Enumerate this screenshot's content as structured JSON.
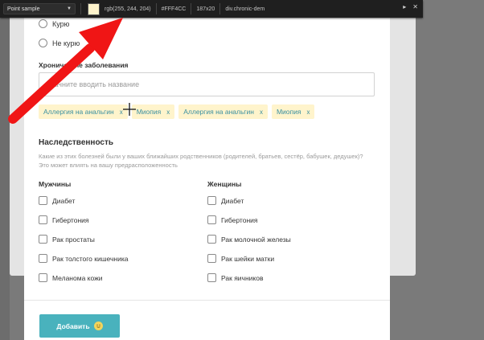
{
  "eyedropper": {
    "mode": "Point sample",
    "swatch_color": "#FFF4CC",
    "rgb": "rgb(255, 244, 204)",
    "hex": "#FFF4CC",
    "size": "187x20",
    "selector": "div.chronic-dem"
  },
  "smoking": {
    "options": [
      "Курю",
      "Не курю"
    ]
  },
  "chronic": {
    "label": "Хронические заболевания",
    "placeholder": "Начните вводить название",
    "tags": [
      {
        "label": "Аллергия на анальгин",
        "remove": "x"
      },
      {
        "label": "Миопия",
        "remove": "x"
      },
      {
        "label": "Аллергия на анальгин",
        "remove": "x"
      },
      {
        "label": "Миопия",
        "remove": "x"
      }
    ]
  },
  "heredity": {
    "title": "Наследственность",
    "description": "Какие из этих болезней были у ваших ближайших родственников (родителей, братьев, сестёр, бабушек, дедушек)? Это может влиять на вашу предрасположенность",
    "men": {
      "title": "Мужчины",
      "items": [
        "Диабет",
        "Гибертония",
        "Рак простаты",
        "Рак толстого кишечника",
        "Меланома кожи"
      ]
    },
    "women": {
      "title": "Женщины",
      "items": [
        "Диабет",
        "Гибертония",
        "Рак молочной железы",
        "Рак шейки матки",
        "Рак яичников"
      ]
    }
  },
  "actions": {
    "add_label": "Добавить"
  },
  "colors": {
    "accent": "#49b2bd",
    "tag_bg": "#FFF4CC",
    "tag_text": "#3a8fa0",
    "arrow": "#f01515"
  }
}
